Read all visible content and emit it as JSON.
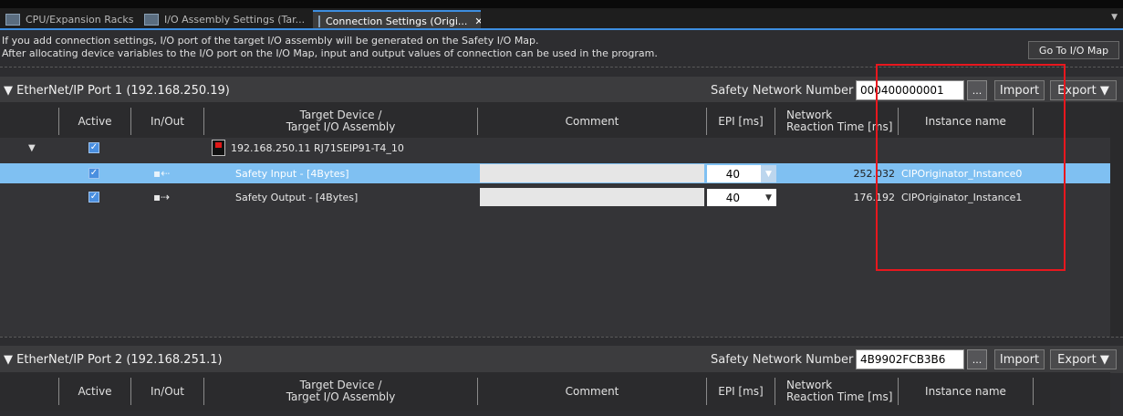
{
  "tabs": [
    {
      "label": "CPU/Expansion Racks",
      "icon": "rack-icon",
      "active": false
    },
    {
      "label": "I/O Assembly Settings (Tar...",
      "icon": "io-assembly-icon",
      "active": false
    },
    {
      "label": "Connection Settings (Origi...",
      "icon": "connection-icon",
      "active": true,
      "close": "✕"
    }
  ],
  "info": {
    "line1": "If you add connection settings, I/O port of the target I/O assembly will be generated on the Safety I/O Map.",
    "line2": "After allocating device variables to the I/O port on the I/O Map, input and output values of connection can be used in the program.",
    "goto_label": "Go To I/O Map"
  },
  "columns": {
    "active": "Active",
    "inout": "In/Out",
    "target1": "Target Device /",
    "target2": "Target I/O Assembly",
    "comment": "Comment",
    "epi": "EPI [ms]",
    "nrt1": "Network",
    "nrt2": "Reaction Time [ms]",
    "instance": "Instance name"
  },
  "port1": {
    "title": "▼ EtherNet/IP Port 1 (192.168.250.19)",
    "sn_label": "Safety Network Number :",
    "sn_value": "000400000001",
    "dots": "...",
    "import_label": "Import",
    "export_label": "Export ▼",
    "device": {
      "expand": "▼",
      "name": "192.168.250.11 RJ71SEIP91-T4_10",
      "active": "✓"
    },
    "connections": [
      {
        "active": "✓",
        "direction": "input",
        "name": "Safety Input - [4Bytes]",
        "epi": "40",
        "nrt": "252.032",
        "instance": "CIPOriginator_Instance0",
        "selected": true
      },
      {
        "active": "✓",
        "direction": "output",
        "name": "Safety Output - [4Bytes]",
        "epi": "40",
        "nrt": "176.192",
        "instance": "CIPOriginator_Instance1",
        "selected": false
      }
    ]
  },
  "port2": {
    "title": "▼ EtherNet/IP Port 2 (192.168.251.1)",
    "sn_label": "Safety Network Number :",
    "sn_value": "4B9902FCB3B6",
    "dots": "...",
    "import_label": "Import",
    "export_label": "Export ▼"
  },
  "colors": {
    "accent": "#3d8ee0",
    "selected_row": "#7fc0f2",
    "highlight_box": "#e8171e",
    "background": "#2d2d30"
  }
}
